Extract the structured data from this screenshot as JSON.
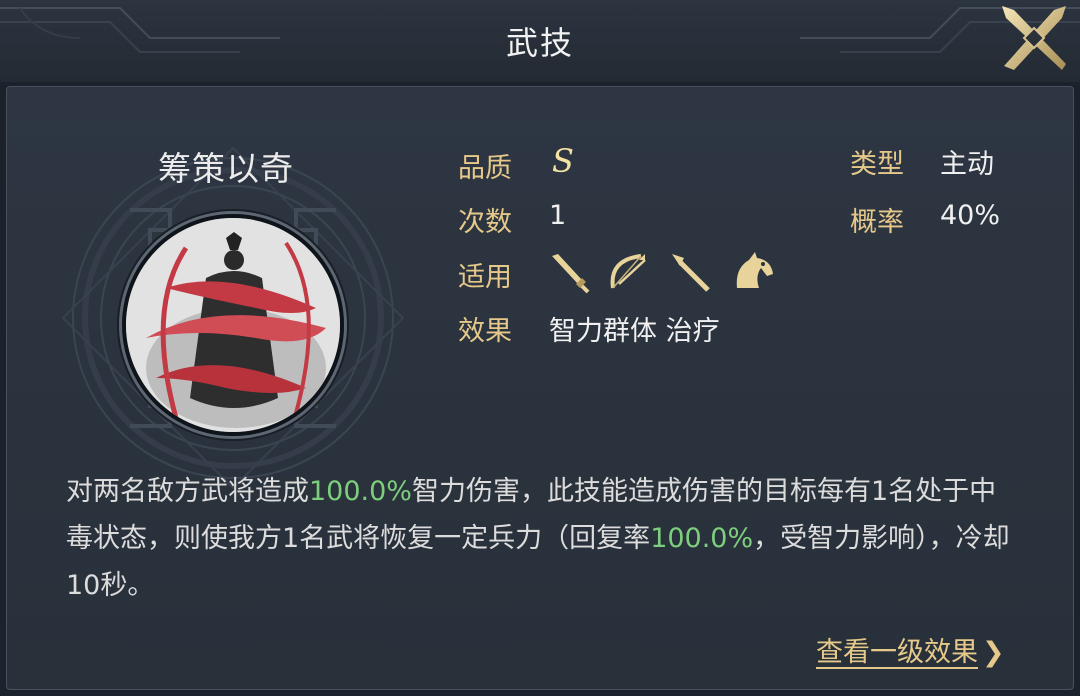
{
  "header": {
    "title": "武技"
  },
  "skill": {
    "name": "筹策以奇",
    "quality_label": "品质",
    "quality_value": "S",
    "count_label": "次数",
    "count_value": "1",
    "applicable_label": "适用",
    "applicable_icons": [
      "sword-icon",
      "bow-icon",
      "spear-icon",
      "horse-icon"
    ],
    "effect_label": "效果",
    "effect_value": "智力群体 治疗",
    "type_label": "类型",
    "type_value": "主动",
    "chance_label": "概率",
    "chance_value": "40%"
  },
  "description": {
    "p1": "对两名敌方武将造成",
    "v1": "100.0%",
    "p2": "智力伤害，此技能造成伤害的目标每有1名处于中毒状态，则使我方1名武将恢复一定兵力（回复率",
    "v2": "100.0%",
    "p3": "，受智力影响），冷却10秒。"
  },
  "footer": {
    "link_label": "查看一级效果",
    "link_chevron": "❯"
  },
  "colors": {
    "accent_gold": "#e6c98a",
    "highlight_green": "#7dcf7d",
    "background": "#2a323d"
  }
}
